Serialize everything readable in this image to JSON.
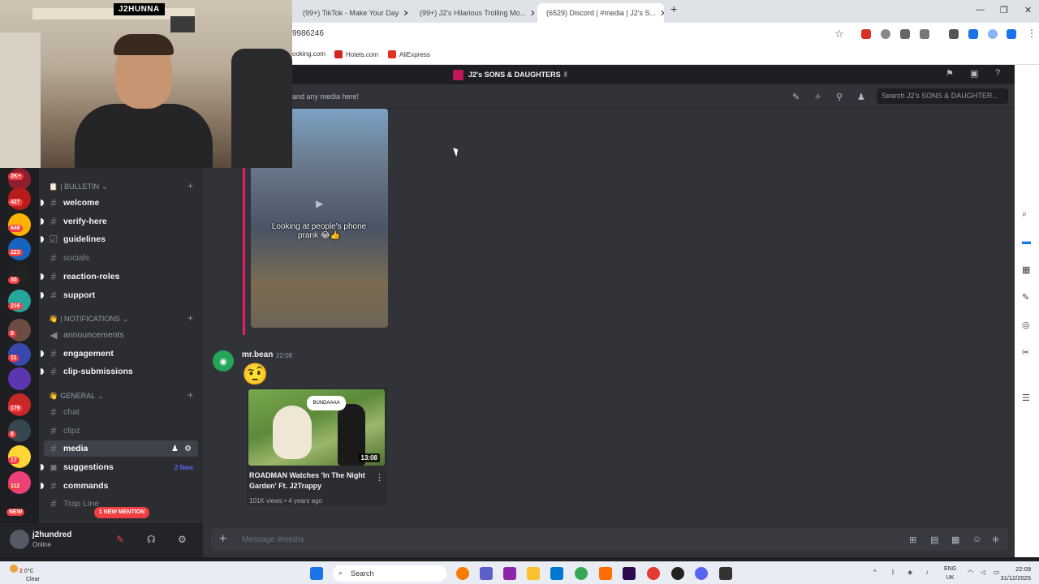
{
  "browser": {
    "tabs": [
      {
        "title": "(99+) TikTok - Make Your Day",
        "favicon_color": "#e6e6e6"
      },
      {
        "title": "(99+) J2's Hilarious Trolling Mo...",
        "favicon_color": "#111111"
      },
      {
        "title": "(6529) Discord | #media | J2's S...",
        "favicon_color": "#5865f2",
        "active": true
      }
    ],
    "new_tab": "+",
    "address": "9986246",
    "bookmarks": [
      "ooking.com",
      "Hotels.com",
      "AliExpress"
    ]
  },
  "webcam": {
    "label": "J2HUNNA"
  },
  "discord": {
    "server_title": "J2's SONS & DAUGHTERS ✌",
    "channel_topic": "and any media here!",
    "search_placeholder": "Search J2's SONS & DAUGHTER...",
    "categories": [
      {
        "name": "| BULLETIN",
        "emoji": "📋"
      },
      {
        "name": "| NOTIFICATIONS",
        "emoji": "👋"
      },
      {
        "name": "GENERAL",
        "emoji": "👋"
      }
    ],
    "channels": {
      "welcome": "welcome",
      "verify": "verify-here",
      "guidelines": "guidelines",
      "socials": "socials",
      "reaction_roles": "reaction-roles",
      "support": "support",
      "announcements": "announcements",
      "engagement": "engagement",
      "clip_submissions": "clip-submissions",
      "chat": "chat",
      "clipz": "clipz",
      "media": "media",
      "suggestions": "suggestions",
      "commands": "commands",
      "trap_line": "Trap Line"
    },
    "suggestions_badge": "2 New",
    "mention_pill": "1 NEW MENTION",
    "server_badges": [
      "2K+",
      "427",
      "648",
      "223",
      "30",
      "216",
      "9",
      "11",
      "179",
      "8",
      "17",
      "112",
      "NEW"
    ],
    "user": {
      "name": "j2hundred",
      "status": "Online"
    },
    "video1": {
      "caption": "Looking at people's phone prank 😂👍"
    },
    "message": {
      "author": "mr.bean",
      "time": "22:08",
      "emoji": "🤨",
      "youtube": {
        "thumb_text": "BUNDAAAA",
        "duration": "13:08",
        "title": "ROADMAN Watches 'In The Night Garden' Ft. J2Trappy",
        "meta": "101K views • 4 years ago"
      }
    },
    "composer_placeholder": "Message #media"
  },
  "taskbar": {
    "weather_temp": "0°C",
    "weather_desc": "Clear",
    "weather_badge": "2",
    "search": "Search",
    "lang_top": "ENG",
    "lang_bottom": "UK",
    "time": "22:09",
    "date": "31/12/2025"
  },
  "colors": {
    "discord_bg": "#313338",
    "channel_bg": "#2b2d31",
    "accent": "#5865f2",
    "mention_red": "#f23f43",
    "embed_bar": "#e91e63"
  }
}
